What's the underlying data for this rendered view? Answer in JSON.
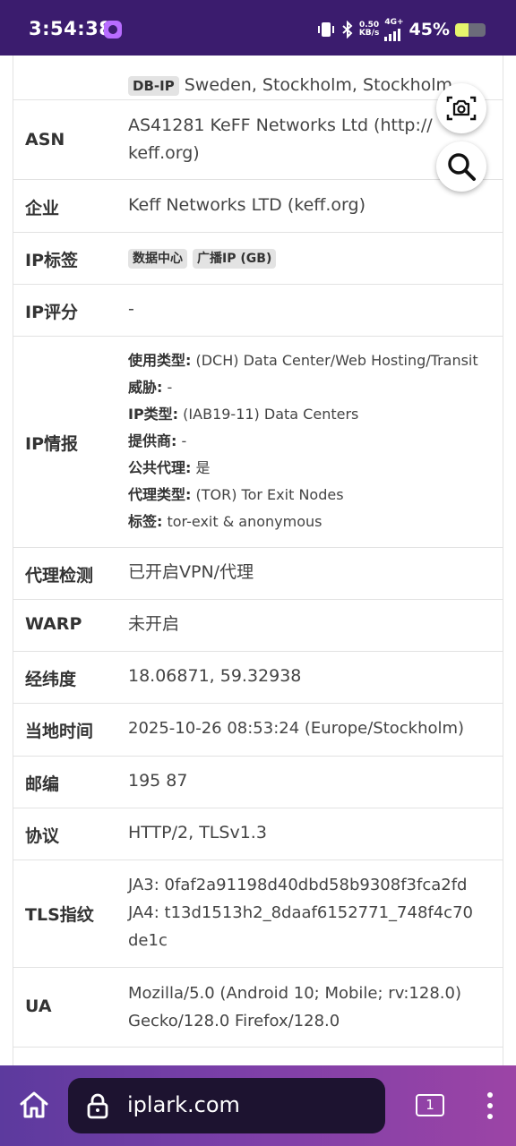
{
  "status_bar": {
    "time": "3:54:38",
    "net_speed_value": "0.50",
    "net_speed_unit": "KB/s",
    "network": "4G+",
    "battery_percent": "45%",
    "battery_level": 0.45,
    "icons": [
      "app-icon",
      "vibrate-icon",
      "bluetooth-icon",
      "signal-icon",
      "battery-icon"
    ]
  },
  "location": {
    "badge": "DB-IP",
    "value": "Sweden, Stockholm, Stockholm"
  },
  "rows": {
    "asn": {
      "label": "ASN",
      "value": "AS41281 KeFF Networks Ltd (http://keff.org)",
      "value_line1": "AS41281 KeFF Networks Ltd (http://",
      "value_line2": "keff.org)"
    },
    "org": {
      "label": "企业",
      "value": "Keff Networks LTD (keff.org)"
    },
    "ip_tags": {
      "label": "IP标签",
      "tags": [
        "数据中心",
        "广播IP (GB)"
      ]
    },
    "ip_score": {
      "label": "IP评分",
      "value": "-"
    },
    "ip_intel": {
      "label": "IP情报",
      "items": [
        {
          "key": "使用类型:",
          "value": " (DCH) Data Center/Web Hosting/Transit"
        },
        {
          "key": "威胁:",
          "value": " -"
        },
        {
          "key": "IP类型:",
          "value": " (IAB19-11) Data Centers"
        },
        {
          "key": "提供商:",
          "value": " -"
        },
        {
          "key": "公共代理:",
          "value": " 是"
        },
        {
          "key": "代理类型:",
          "value": " (TOR) Tor Exit Nodes"
        },
        {
          "key": "标签:",
          "value": " tor-exit & anonymous"
        }
      ]
    },
    "proxy": {
      "label": "代理检测",
      "value": "已开启VPN/代理"
    },
    "warp": {
      "label": "WARP",
      "value": "未开启"
    },
    "coords": {
      "label": "经纬度",
      "value": "18.06871, 59.32938"
    },
    "local_time": {
      "label": "当地时间",
      "value": "2025-10-26 08:53:24 (Europe/Stockholm)"
    },
    "postal": {
      "label": "邮编",
      "value": "195 87"
    },
    "protocol": {
      "label": "协议",
      "value": "HTTP/2, TLSv1.3"
    },
    "tls": {
      "label": "TLS指纹",
      "ja3": "JA3: 0faf2a91198d40dbd58b9308f3fca2fd",
      "ja4_line1": "JA4: t13d1513h2_8daaf6152771_748f4c70",
      "ja4_line2": "de1c"
    },
    "ua": {
      "label": "UA",
      "line1": "Mozilla/5.0 (Android 10; Mobile; rv:128.0)",
      "line2": "Gecko/128.0 Firefox/128.0"
    }
  },
  "floating": {
    "screenshot_icon": "camera-scan-icon",
    "search_icon": "search-icon"
  },
  "bottom_bar": {
    "url": "iplark.com",
    "tab_count": "1",
    "icons": [
      "home-icon",
      "lock-icon",
      "tabs-icon",
      "more-icon"
    ],
    "gradient": [
      "#5c3a9e",
      "#9c44a6"
    ]
  },
  "colors": {
    "status_bar": "#3b1c6e",
    "badge_bg": "#e3e3e3",
    "url_pill": "#1d1330"
  }
}
